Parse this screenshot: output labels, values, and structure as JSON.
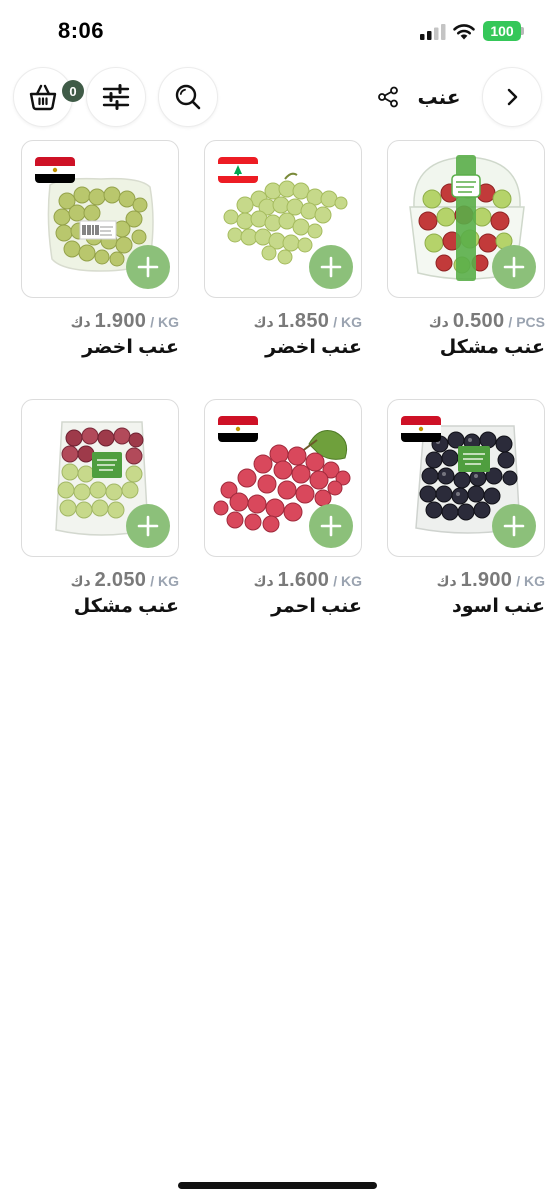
{
  "status_bar": {
    "time": "8:06",
    "battery": "100"
  },
  "header": {
    "title": "عنب",
    "cart_count": "0"
  },
  "products": [
    {
      "name": "عنب اخضر",
      "price": "1.900",
      "currency": "دك",
      "unit": "KG",
      "flag": "egypt",
      "image": "green-grapes-bag"
    },
    {
      "name": "عنب اخضر",
      "price": "1.850",
      "currency": "دك",
      "unit": "KG",
      "flag": "lebanon",
      "image": "green-grapes-bunch"
    },
    {
      "name": "عنب مشكل",
      "price": "0.500",
      "currency": "دك",
      "unit": "PCS",
      "flag": "",
      "image": "mixed-grapes-cup"
    },
    {
      "name": "عنب مشكل",
      "price": "2.050",
      "currency": "دك",
      "unit": "KG",
      "flag": "",
      "image": "mixed-grapes-tray"
    },
    {
      "name": "عنب احمر",
      "price": "1.600",
      "currency": "دك",
      "unit": "KG",
      "flag": "egypt",
      "image": "red-grapes-bunch"
    },
    {
      "name": "عنب اسود",
      "price": "1.900",
      "currency": "دك",
      "unit": "KG",
      "flag": "egypt",
      "image": "black-grapes-tray"
    }
  ],
  "colors": {
    "accent_green": "#8cc07a",
    "badge": "#3f5b47",
    "battery": "#35c759"
  }
}
